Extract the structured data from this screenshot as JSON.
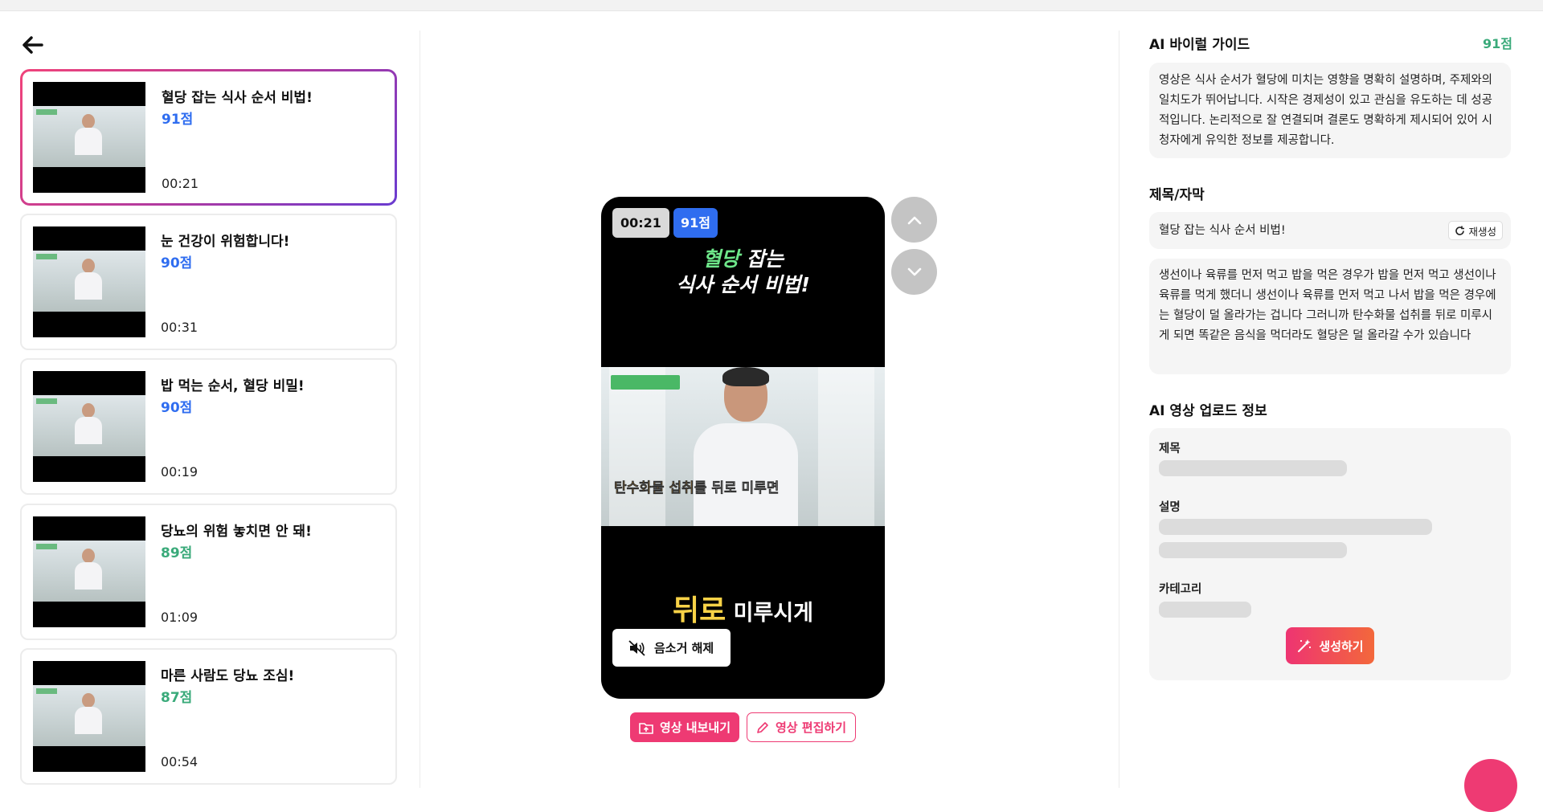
{
  "nav": {
    "back_icon": "arrow-left-icon"
  },
  "videos": [
    {
      "title": "혈당 잡는 식사 순서 비법!",
      "score": "91점",
      "duration": "00:21",
      "score_color": "#2f6df0",
      "active": true
    },
    {
      "title": "눈 건강이 위험합니다!",
      "score": "90점",
      "duration": "00:31",
      "score_color": "#2f6df0",
      "active": false
    },
    {
      "title": "밥 먹는 순서, 혈당 비밀!",
      "score": "90점",
      "duration": "00:19",
      "score_color": "#2f6df0",
      "active": false
    },
    {
      "title": "당뇨의 위험 놓치면 안 돼!",
      "score": "89점",
      "duration": "01:09",
      "score_color": "#3aaa7a",
      "active": false
    },
    {
      "title": "마른 사람도 당뇨 조심!",
      "score": "87점",
      "duration": "00:54",
      "score_color": "#3aaa7a",
      "active": false
    }
  ],
  "preview": {
    "time_badge": "00:21",
    "score_badge": "91점",
    "headline_highlight": "혈당",
    "headline_rest_line1": " 잡는",
    "headline_line2": "식사 순서 비법!",
    "video_caption_a": "탄수화물 섭취",
    "video_caption_b": "를 뒤로 미루면",
    "subtitle_highlight": "뒤로",
    "subtitle_rest": " 미루시게",
    "unmute_label": "음소거 해제"
  },
  "actions": {
    "export_label": "영상 내보내기",
    "edit_label": "영상 편집하기"
  },
  "guide": {
    "heading": "AI 바이럴 가이드",
    "score": "91점",
    "text": "영상은 식사 순서가 혈당에 미치는 영향을 명확히 설명하며, 주제와의 일치도가 뛰어납니다. 시작은 경제성이 있고 관심을 유도하는 데 성공적입니다. 논리적으로 잘 연결되며 결론도 명확하게 제시되어 있어 시청자에게 유익한 정보를 제공합니다."
  },
  "title_caption": {
    "heading": "제목/자막",
    "title_value": "혈당 잡는 식사 순서 비법!",
    "regenerate_label": "재생성",
    "caption_text": "생선이나 육류를 먼저 먹고 밥을 먹은 경우가 밥을 먼저 먹고 생선이나 육류를 먹게 했더니 생선이나 육류를 먼저 먹고 나서 밥을 먹은 경우에는 혈당이 덜 올라가는 겁니다 그러니까 탄수화물 섭취를 뒤로 미루시게 되면 똑같은 음식을 먹더라도 혈당은 덜 올라갈 수가 있습니다"
  },
  "upload_info": {
    "heading": "AI 영상 업로드 정보",
    "title_label": "제목",
    "desc_label": "설명",
    "category_label": "카테고리",
    "generate_label": "생성하기"
  }
}
